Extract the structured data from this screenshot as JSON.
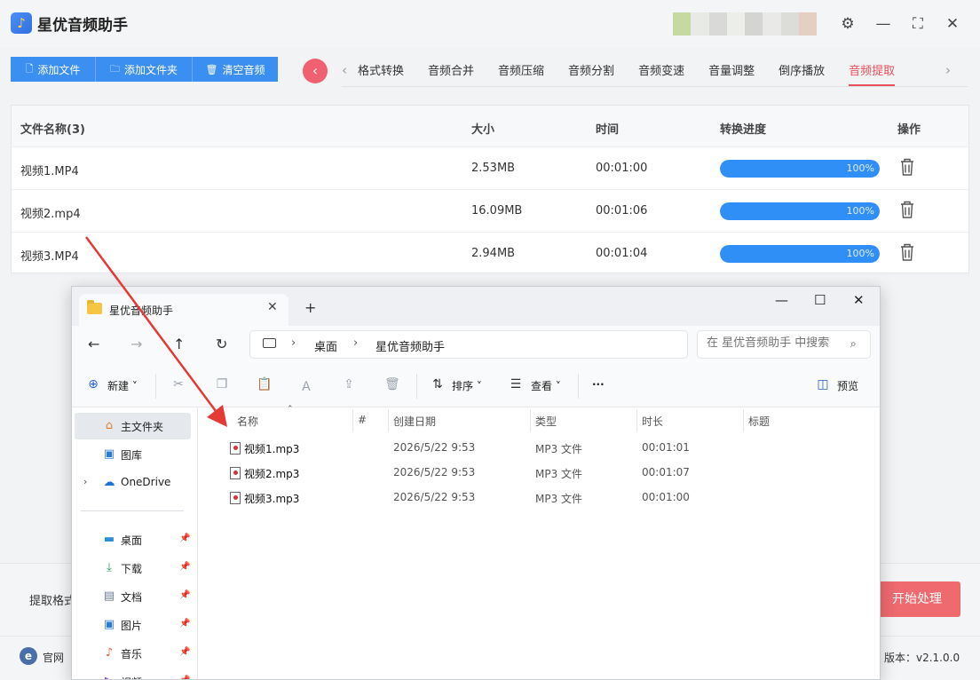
{
  "app": {
    "title": "星优音频助手",
    "logo_glyph": "♪"
  },
  "toolbar": {
    "add_file": "添加文件",
    "add_folder": "添加文件夹",
    "clear_audio": "清空音频"
  },
  "tabs": [
    "格式转换",
    "音频合并",
    "音频压缩",
    "音频分割",
    "音频变速",
    "音量调整",
    "倒序播放",
    "音频提取"
  ],
  "active_tab": "音频提取",
  "file_table": {
    "headers": {
      "name": "文件名称(3)",
      "size": "大小",
      "time": "时间",
      "progress": "转换进度",
      "actions": "操作"
    },
    "rows": [
      {
        "name": "视频1.MP4",
        "size": "2.53MB",
        "time": "00:01:00",
        "progress": 1.0,
        "progress_label": "100%"
      },
      {
        "name": "视频2.mp4",
        "size": "16.09MB",
        "time": "00:01:06",
        "progress": 1.0,
        "progress_label": "100%"
      },
      {
        "name": "视频3.MP4",
        "size": "2.94MB",
        "time": "00:01:04",
        "progress": 1.0,
        "progress_label": "100%"
      }
    ]
  },
  "bottom": {
    "extract_label": "提取格式",
    "start_button": "开始处理"
  },
  "footer": {
    "site_label": "官网",
    "version": "版本：v2.1.0.0"
  },
  "explorer": {
    "tab_title": "星优音频助手",
    "breadcrumb": [
      "桌面",
      "星优音频助手"
    ],
    "search_placeholder": "在 星优音频助手 中搜索",
    "commands": {
      "new": "新建",
      "sort": "排序",
      "view": "查看",
      "more": "···",
      "preview": "预览"
    },
    "sidebar": [
      {
        "label": "主文件夹",
        "icon": "home-icon",
        "pinned": false
      },
      {
        "label": "图库",
        "icon": "gallery-icon",
        "pinned": false
      },
      {
        "label": "OneDrive",
        "icon": "cloud-icon",
        "pinned": false
      },
      {
        "label": "桌面",
        "icon": "desktop-icon",
        "pinned": true
      },
      {
        "label": "下载",
        "icon": "download-icon",
        "pinned": true
      },
      {
        "label": "文档",
        "icon": "document-icon",
        "pinned": true
      },
      {
        "label": "图片",
        "icon": "picture-icon",
        "pinned": true
      },
      {
        "label": "音乐",
        "icon": "music-icon",
        "pinned": true
      },
      {
        "label": "视频",
        "icon": "video-icon",
        "pinned": true
      }
    ],
    "columns": {
      "name": "名称",
      "number": "#",
      "created": "创建日期",
      "type": "类型",
      "duration": "时长",
      "title": "标题"
    },
    "files": [
      {
        "name": "视频1.mp3",
        "created": "2026/5/22 9:53",
        "type": "MP3 文件",
        "duration": "00:01:01"
      },
      {
        "name": "视频2.mp3",
        "created": "2026/5/22 9:53",
        "type": "MP3 文件",
        "duration": "00:01:07"
      },
      {
        "name": "视频3.mp3",
        "created": "2026/5/22 9:53",
        "type": "MP3 文件",
        "duration": "00:01:00"
      }
    ]
  },
  "colors": {
    "primary_blue": "#3b8ff0",
    "accent_red": "#e8505b",
    "progress_fill": "#2f8ff7",
    "arrow_red": "#e53935"
  }
}
